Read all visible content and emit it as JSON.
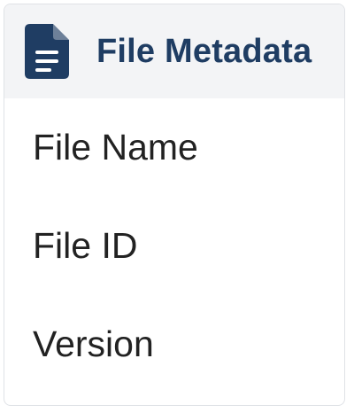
{
  "panel": {
    "title": "File Metadata",
    "icon": "document-icon",
    "accent_color": "#1f3d63",
    "header_background": "#f3f4f6"
  },
  "fields": [
    {
      "label": "File Name"
    },
    {
      "label": "File ID"
    },
    {
      "label": "Version"
    }
  ]
}
